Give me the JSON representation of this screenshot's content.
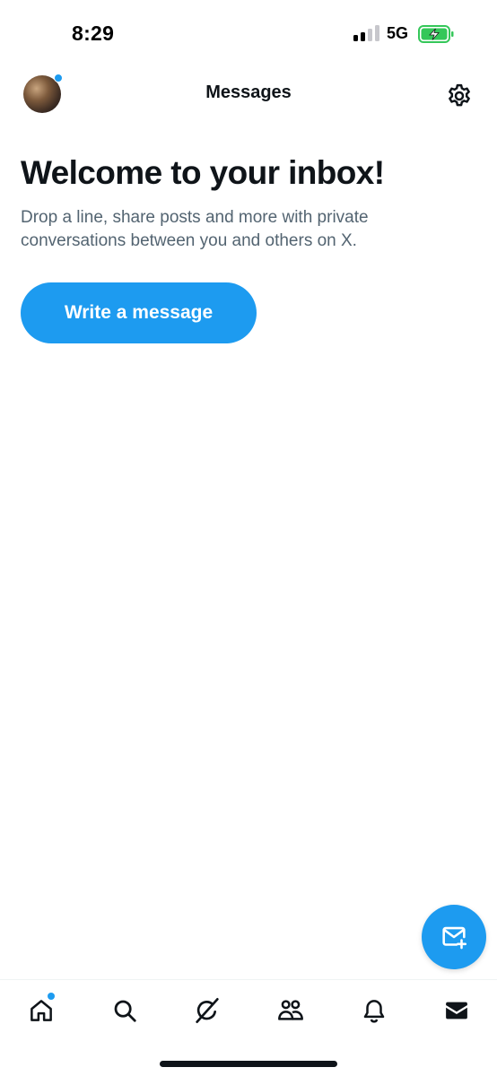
{
  "status_bar": {
    "time": "8:29",
    "network": "5G",
    "signal_icon": "signal-bars-icon",
    "battery_icon": "battery-charging-icon"
  },
  "header": {
    "title": "Messages",
    "avatar_icon": "profile-avatar",
    "settings_icon": "gear-icon"
  },
  "main": {
    "welcome_title": "Welcome to your inbox!",
    "welcome_text": "Drop a line, share posts and more with private conversations between you and others on X.",
    "write_button_label": "Write a message"
  },
  "fab": {
    "icon": "new-message-icon"
  },
  "bottom_nav": {
    "items": [
      {
        "icon": "home-icon",
        "has_notification_dot": true
      },
      {
        "icon": "search-icon",
        "has_notification_dot": false
      },
      {
        "icon": "grok-icon",
        "has_notification_dot": false
      },
      {
        "icon": "communities-icon",
        "has_notification_dot": false
      },
      {
        "icon": "bell-icon",
        "has_notification_dot": false
      },
      {
        "icon": "mail-icon",
        "has_notification_dot": false,
        "active": true
      }
    ]
  },
  "colors": {
    "accent": "#1d9bf0",
    "text_primary": "#0f1419",
    "text_secondary": "#536471",
    "battery_green": "#34c759"
  }
}
